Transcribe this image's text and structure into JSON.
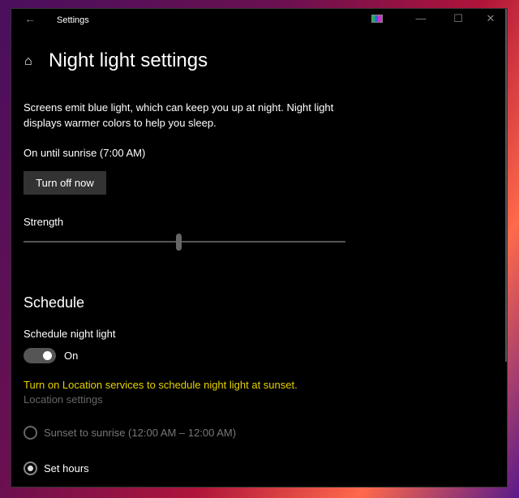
{
  "window": {
    "title": "Settings",
    "minimize": "—",
    "maximize": "☐",
    "close": "✕",
    "back": "←"
  },
  "page": {
    "title": "Night light settings",
    "description": "Screens emit blue light, which can keep you up at night. Night light displays warmer colors to help you sleep.",
    "status": "On until sunrise (7:00 AM)",
    "turn_off_label": "Turn off now",
    "strength_label": "Strength",
    "strength_percent": 48
  },
  "schedule": {
    "heading": "Schedule",
    "toggle_label": "Schedule night light",
    "toggle_state": "On",
    "warning": "Turn on Location services to schedule night light at sunset.",
    "location_link": "Location settings",
    "options": [
      {
        "label": "Sunset to sunrise (12:00 AM – 12:00 AM)",
        "selected": false,
        "disabled": true
      },
      {
        "label": "Set hours",
        "selected": true,
        "disabled": false
      }
    ]
  },
  "colors": {
    "warning": "#e6d200",
    "disabled": "#666666",
    "background": "#000000"
  }
}
